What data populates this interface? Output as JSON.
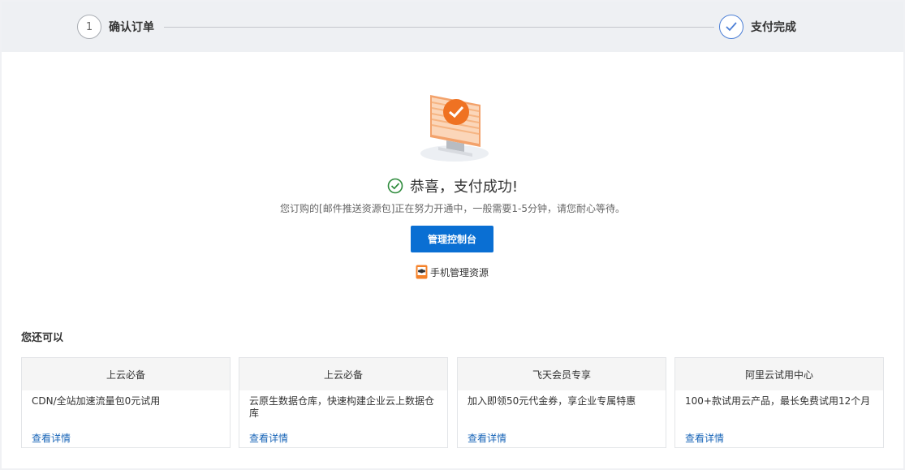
{
  "steps": [
    {
      "index": "1",
      "label": "确认订单"
    },
    {
      "label": "支付完成",
      "done": true
    }
  ],
  "success": {
    "title": "恭喜，支付成功!",
    "description": "您订购的[邮件推送资源包]正在努力开通中，一般需要1-5分钟，请您耐心等待。"
  },
  "actions": {
    "console_button": "管理控制台",
    "mobile_link": "手机管理资源"
  },
  "more": {
    "title": "您还可以",
    "cards": [
      {
        "header": "上云必备",
        "body": "CDN/全站加速流量包0元试用",
        "link": "查看详情"
      },
      {
        "header": "上云必备",
        "body": "云原生数据仓库，快速构建企业云上数据仓库",
        "link": "查看详情"
      },
      {
        "header": "飞天会员专享",
        "body": "加入即领50元代金券，享企业专属特惠",
        "link": "查看详情"
      },
      {
        "header": "阿里云试用中心",
        "body": "100+款试用云产品，最长免费试用12个月",
        "link": "查看详情"
      }
    ]
  },
  "colors": {
    "primary": "#0a6fd3",
    "success": "#2e8b3c",
    "link": "#1a66b8",
    "accent_orange": "#f5822a"
  },
  "icons": {
    "step_done": "check-icon",
    "success": "check-circle-icon",
    "mobile": "phone-icon",
    "hero": "monitor-check-illustration"
  }
}
